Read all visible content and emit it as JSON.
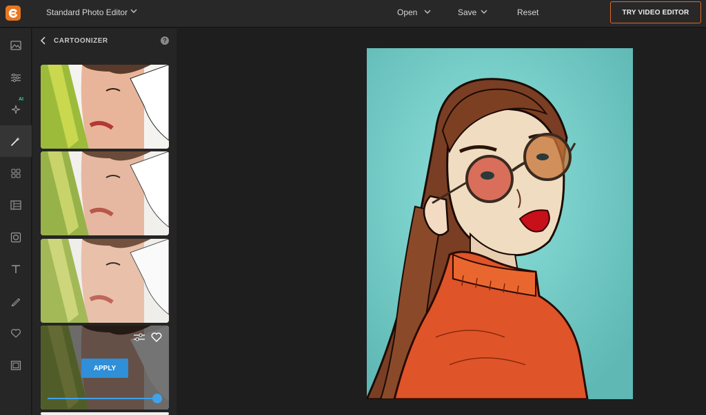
{
  "header": {
    "app_title": "Standard Photo Editor",
    "menu": [
      {
        "label": "Open"
      },
      {
        "label": "Save"
      },
      {
        "label": "Reset"
      }
    ],
    "try_button": "TRY VIDEO EDITOR",
    "brand_color": "#e8761f",
    "accent_border": "#e06a2c"
  },
  "rail": {
    "items": [
      {
        "icon": "image-icon"
      },
      {
        "icon": "sliders-icon"
      },
      {
        "icon": "ai-sparkle-icon",
        "badge": "AI"
      },
      {
        "icon": "magic-wand-icon",
        "active": true
      },
      {
        "icon": "grid-icon"
      },
      {
        "icon": "layout-icon"
      },
      {
        "icon": "frame-icon"
      },
      {
        "icon": "text-icon"
      },
      {
        "icon": "brush-icon"
      },
      {
        "icon": "heart-icon"
      },
      {
        "icon": "border-icon"
      }
    ]
  },
  "panel": {
    "title": "CARTOONIZER",
    "help": "?",
    "apply_label": "APPLY",
    "slider_value": 1.0,
    "accent_color": "#2f8fd8"
  },
  "canvas": {
    "background": "#6cc9c4"
  }
}
